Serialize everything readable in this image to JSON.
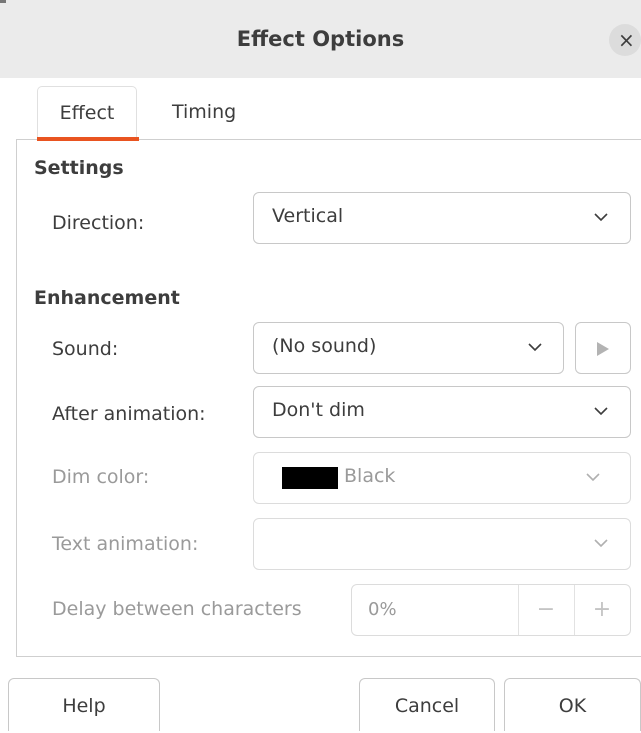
{
  "dialog": {
    "title": "Effect Options"
  },
  "tabs": [
    {
      "label": "Effect",
      "selected": true
    },
    {
      "label": "Timing",
      "selected": false
    }
  ],
  "settings": {
    "heading": "Settings",
    "direction": {
      "label": "Direction:",
      "value": "Vertical"
    }
  },
  "enhancement": {
    "heading": "Enhancement",
    "sound": {
      "label": "Sound:",
      "value": "(No sound)"
    },
    "after_animation": {
      "label": "After animation:",
      "value": "Don't dim"
    },
    "dim_color": {
      "label": "Dim color:",
      "value": "Black",
      "swatch": "#000000",
      "enabled": false
    },
    "text_animation": {
      "label": "Text animation:",
      "value": "",
      "enabled": false
    },
    "delay": {
      "label": "Delay between characters",
      "value": "0%",
      "enabled": false
    }
  },
  "buttons": {
    "help": "Help",
    "cancel": "Cancel",
    "ok": "OK"
  },
  "colors": {
    "accent": "#e95420",
    "titlebar": "#ebebeb",
    "disabled_text": "#9a9a9a"
  }
}
